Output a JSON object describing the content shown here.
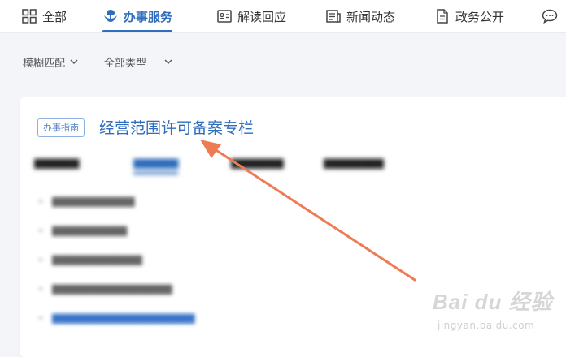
{
  "nav": {
    "tabs": [
      {
        "label": "全部",
        "icon": "grid-icon"
      },
      {
        "label": "办事服务",
        "icon": "service-emblem-icon",
        "active": true
      },
      {
        "label": "解读回应",
        "icon": "id-card-icon"
      },
      {
        "label": "新闻动态",
        "icon": "newspaper-icon"
      },
      {
        "label": "政务公开",
        "icon": "document-icon"
      },
      {
        "label": "",
        "icon": "chat-bubble-icon"
      }
    ]
  },
  "filters": {
    "match": "模糊匹配",
    "type": "全部类型"
  },
  "result": {
    "badge": "办事指南",
    "title": "经营范围许可备案专栏"
  },
  "watermark": {
    "brand": "Bai du 经验",
    "site": "jingyan.baidu.com"
  },
  "colors": {
    "accent": "#2f6dbd",
    "annotation_arrow": "#ef7b55",
    "page_background": "#f4f5f9"
  }
}
